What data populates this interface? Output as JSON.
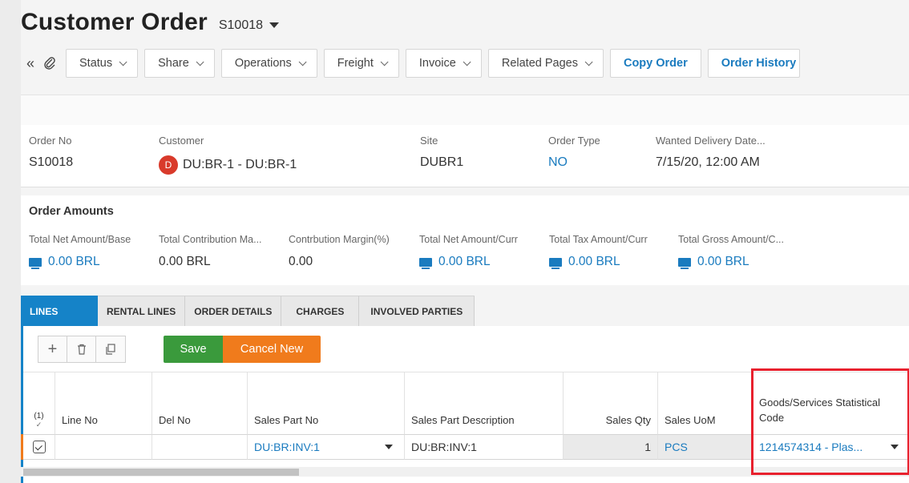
{
  "header": {
    "title": "Customer Order",
    "order_id": "S10018"
  },
  "toolbar": {
    "collapse_icon": "double-chevron-left-icon",
    "attach_icon": "paperclip-icon",
    "buttons": [
      {
        "label": "Status"
      },
      {
        "label": "Share"
      },
      {
        "label": "Operations"
      },
      {
        "label": "Freight"
      },
      {
        "label": "Invoice"
      },
      {
        "label": "Related Pages"
      }
    ],
    "copy_order": "Copy Order",
    "order_history": "Order History"
  },
  "order": {
    "order_no_label": "Order No",
    "order_no": "S10018",
    "customer_label": "Customer",
    "customer_initial": "D",
    "customer": "DU:BR-1 - DU:BR-1",
    "site_label": "Site",
    "site": "DUBR1",
    "order_type_label": "Order Type",
    "order_type": "NO",
    "wanted_delivery_label": "Wanted Delivery Date...",
    "wanted_delivery": "7/15/20, 12:00 AM"
  },
  "amounts": {
    "title": "Order Amounts",
    "fields": [
      {
        "label": "Total Net Amount/Base",
        "value": "0.00 BRL"
      },
      {
        "label": "Total Contribution Ma...",
        "value": "0.00 BRL"
      },
      {
        "label": "Contrbution Margin(%)",
        "value": "0.00"
      },
      {
        "label": "Total Net Amount/Curr",
        "value": "0.00 BRL"
      },
      {
        "label": "Total Tax Amount/Curr",
        "value": "0.00 BRL"
      },
      {
        "label": "Total Gross Amount/C...",
        "value": "0.00 BRL"
      }
    ]
  },
  "tabs": [
    "LINES",
    "RENTAL LINES",
    "ORDER DETAILS",
    "CHARGES",
    "INVOLVED PARTIES"
  ],
  "lines_toolbar": {
    "add_icon": "plus-icon",
    "delete_icon": "trash-icon",
    "duplicate_icon": "copy-icon",
    "save": "Save",
    "cancel_new": "Cancel New"
  },
  "grid": {
    "selected_count": "(1)",
    "columns": {
      "line_no": "Line No",
      "del_no": "Del No",
      "sales_part_no": "Sales Part No",
      "sales_part_desc": "Sales Part Description",
      "sales_qty": "Sales Qty",
      "sales_uom": "Sales UoM",
      "stat_code": "Goods/Services Statistical Code"
    },
    "rows": [
      {
        "line_no": "",
        "del_no": "",
        "sales_part_no": "DU:BR:INV:1",
        "sales_part_desc": "DU:BR:INV:1",
        "sales_qty": "1",
        "sales_uom": "PCS",
        "stat_code": "1214574314 - Plas..."
      }
    ]
  },
  "colors": {
    "accent": "#1583c8",
    "link": "#1a7bbf",
    "save": "#3a9a3c",
    "cancel": "#f07b1c",
    "highlight": "#e8212e",
    "avatar": "#d93a2b"
  }
}
